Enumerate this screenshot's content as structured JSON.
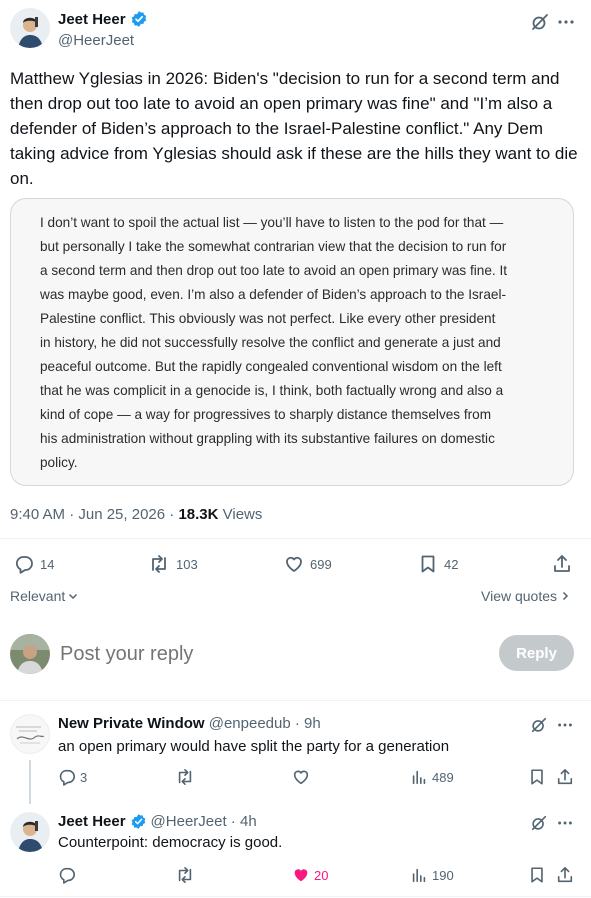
{
  "main_tweet": {
    "author": {
      "name": "Jeet Heer",
      "handle": "@HeerJeet"
    },
    "text": "Matthew Yglesias in 2026: Biden's \"decision to run for a second term and then drop out too late to avoid an open primary was fine\" and \"I’m also a defender of Biden’s approach to the Israel-Palestine conflict.\" Any Dem taking advice from Yglesias should ask if these are the hills they want to die on.",
    "quote_lines": [
      "I don’t want to spoil the actual list — you’ll have to listen to the pod for that —",
      "but personally I take the somewhat contrarian view that the decision to run for",
      "a second term and then drop out too late to avoid an open primary was fine. It",
      "was maybe good, even. I’m also a defender of Biden’s approach to the Israel-",
      "Palestine conflict. This obviously was not perfect. Like every other president",
      "in history, he did not successfully resolve the conflict and generate a just and",
      "peaceful outcome. But the rapidly congealed conventional wisdom on the left",
      "that he was complicit in a genocide is, I think, both factually wrong and also a",
      "kind of cope — a way for progressives to sharply distance themselves from",
      "his administration without grappling with its substantive failures on domestic",
      "policy."
    ],
    "timestamp": "9:40 AM · Jun 25, 2026 · ",
    "views_count": "18.3K",
    "views_label": " Views",
    "stats": {
      "replies": "14",
      "reposts": "103",
      "likes": "699",
      "bookmarks": "42"
    }
  },
  "sort": {
    "relevant": "Relevant",
    "view_quotes": "View quotes"
  },
  "composer": {
    "placeholder": "Post your reply",
    "reply_button": "Reply"
  },
  "replies": [
    {
      "name": "New Private Window",
      "handle": "@enpeedub",
      "time": " · 9h",
      "text": "an open primary would have split the party for a generation",
      "stats": {
        "replies": "3",
        "reposts": "",
        "likes": "",
        "views": "489"
      }
    },
    {
      "name": "Jeet Heer",
      "handle": "@HeerJeet",
      "time": " · 4h",
      "text": "Counterpoint: democracy is good.",
      "stats": {
        "replies": "",
        "reposts": "",
        "likes": "20",
        "views": "190"
      }
    }
  ],
  "colors": {
    "accent": "#1d9bf0",
    "like_pink": "#f91880",
    "text": "#0f1419",
    "muted": "#536471",
    "border": "#cfd9de",
    "reply_btn": "#c4c9cc"
  }
}
